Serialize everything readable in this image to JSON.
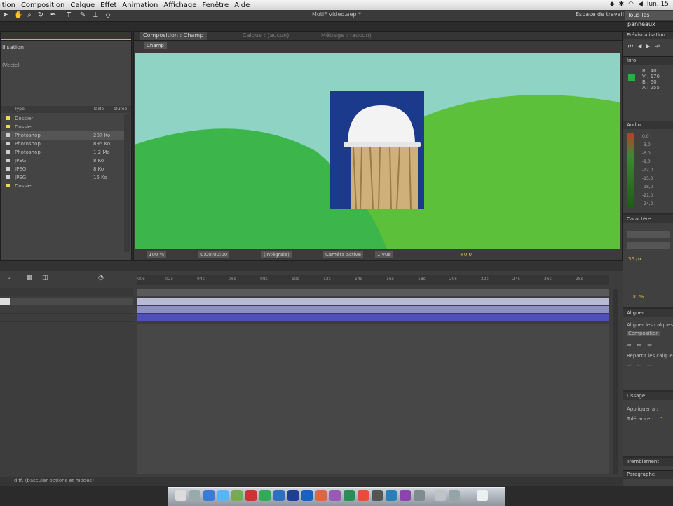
{
  "menubar": {
    "items": [
      "ition",
      "Composition",
      "Calque",
      "Effet",
      "Animation",
      "Affichage",
      "Fenêtre",
      "Aide"
    ],
    "clock": "lun. 15"
  },
  "window": {
    "title": "MotiF video.aep *"
  },
  "toolbar": {
    "workspace_label": "Espace de travail",
    "workspace_value": "Tous les panneaux"
  },
  "project": {
    "header_text": "ilisation",
    "sub_text": "(Vecte)",
    "columns": {
      "type": "Type",
      "size": "Taille",
      "duration": "Durée"
    },
    "rows": [
      {
        "type": "Dossier",
        "size": "",
        "color": "#e8e04a"
      },
      {
        "type": "Dossier",
        "size": "",
        "color": "#e8e04a"
      },
      {
        "type": "Photoshop",
        "size": "287 Ko",
        "color": "#cfcfcf"
      },
      {
        "type": "Photoshop",
        "size": "895 Ko",
        "color": "#cfcfcf"
      },
      {
        "type": "Photoshop",
        "size": "1,2 Mo",
        "color": "#cfcfcf"
      },
      {
        "type": "JPEG",
        "size": "8 Ko",
        "color": "#cfcfcf"
      },
      {
        "type": "JPEG",
        "size": "8 Ko",
        "color": "#cfcfcf"
      },
      {
        "type": "JPEG",
        "size": "15 Ko",
        "color": "#cfcfcf"
      },
      {
        "type": "Dossier",
        "size": "",
        "color": "#e8e04a"
      }
    ]
  },
  "composition": {
    "tabs": [
      "Composition : Champ",
      "Calque : (aucun)",
      "Métrage : (aucun)"
    ],
    "sub_tab": "Champ",
    "zoom": "100 %",
    "timecode": "0:00:00:00",
    "resolution": "(Intégrale)",
    "camera": "Caméra active",
    "views": "1 vue",
    "exposure": "+0,0"
  },
  "timeline": {
    "ruler_labels": [
      "00s",
      "02s",
      "04s",
      "06s",
      "08s",
      "10s",
      "12s",
      "14s",
      "16s",
      "18s",
      "20s",
      "22s",
      "24s",
      "26s",
      "28s"
    ]
  },
  "right": {
    "preview_title": "Prévisualisation",
    "info_title": "Info",
    "info_values": [
      "R : 40",
      "V : 176",
      "B : 60",
      "A : 255"
    ],
    "audio_title": "Audio",
    "audio_scale": [
      "0,0",
      "-3,0",
      "-6,0",
      "-9,0",
      "-12,0",
      "-15,0",
      "-18,0",
      "-21,0",
      "-24,0"
    ],
    "character_title": "Caractère",
    "character_size": "36 px",
    "character_scale": "100 %",
    "align_title": "Aligner",
    "align_label": "Aligner les calques sur :",
    "align_target": "Composition",
    "distribute_label": "Répartir les calques",
    "smoother_title": "Lissage",
    "smoother_apply": "Appliquer à :",
    "smoother_tolerance": "Tolérance :",
    "smoother_tol_value": "1",
    "wiggler_title": "Tremblement",
    "paragraph_title": "Paragraphe"
  },
  "status": {
    "text": "diff. (basculer options et modes)"
  },
  "colors": {
    "sky": "#8fd3c4",
    "hill_dark": "#3cb54a",
    "hill_light": "#5cc03a",
    "photo_bg": "#1c3a8c",
    "layer_bar_light": "#b9bbd6",
    "layer_bar_mid": "#8c8fc4",
    "layer_bar_dark": "#4c50b8"
  }
}
